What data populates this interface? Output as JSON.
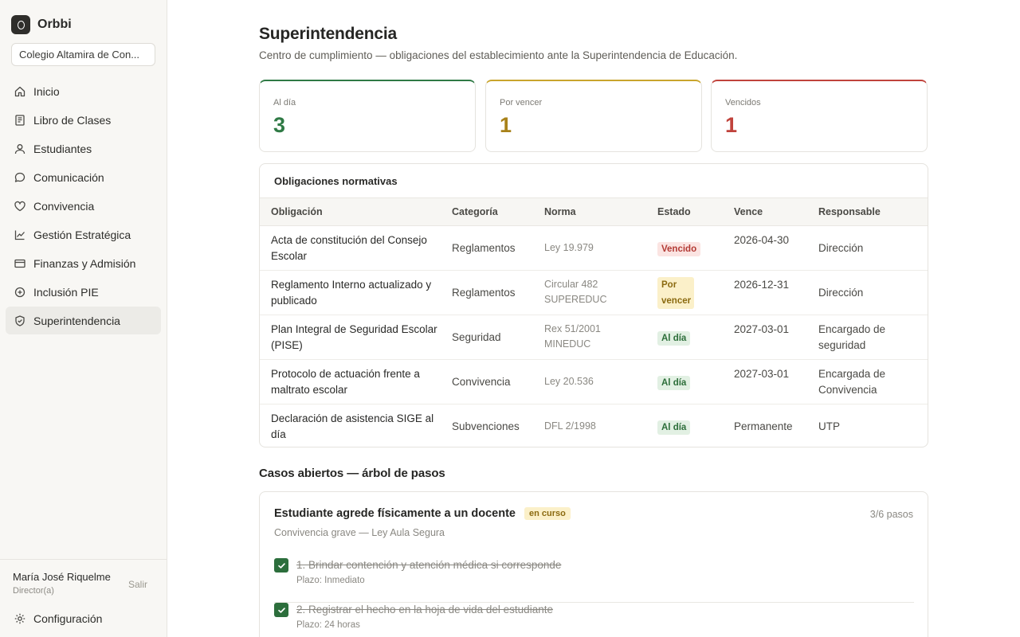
{
  "app": {
    "name": "Orbbi"
  },
  "sidebar": {
    "school": "Colegio Altamira de Con...",
    "items": [
      {
        "label": "Inicio",
        "icon": "home-icon"
      },
      {
        "label": "Libro de Clases",
        "icon": "book-icon"
      },
      {
        "label": "Estudiantes",
        "icon": "user-icon"
      },
      {
        "label": "Comunicación",
        "icon": "chat-icon"
      },
      {
        "label": "Convivencia",
        "icon": "heart-icon"
      },
      {
        "label": "Gestión Estratégica",
        "icon": "chart-icon"
      },
      {
        "label": "Finanzas y Admisión",
        "icon": "card-icon"
      },
      {
        "label": "Inclusión PIE",
        "icon": "plus-circle-icon"
      },
      {
        "label": "Superintendencia",
        "icon": "shield-icon",
        "active": true
      }
    ],
    "user": {
      "name": "María José Riquelme",
      "role": "Director(a)",
      "logout": "Salir"
    },
    "settings": "Configuración"
  },
  "page": {
    "title": "Superintendencia",
    "subtitle": "Centro de cumplimiento — obligaciones del establecimiento ante la Superintendencia de Educación."
  },
  "kpis": [
    {
      "label": "Al día",
      "value": "3",
      "color": "#2f7a45"
    },
    {
      "label": "Por vencer",
      "value": "1",
      "color": "#a8821a"
    },
    {
      "label": "Vencidos",
      "value": "1",
      "color": "#c0433c"
    }
  ],
  "obligations": {
    "title": "Obligaciones normativas",
    "headers": [
      "Obligación",
      "Categoría",
      "Norma",
      "Estado",
      "Vence",
      "Responsable"
    ],
    "rows": [
      {
        "obligacion": "Acta de constitución del Consejo Escolar",
        "categoria": "Reglamentos",
        "norma": "Ley 19.979",
        "estado": "Vencido",
        "estado_type": "overdue",
        "vence": "2026-04-30",
        "responsable": "Dirección"
      },
      {
        "obligacion": "Reglamento Interno actualizado y publicado",
        "categoria": "Reglamentos",
        "norma": "Circular 482 SUPEREDUC",
        "estado": "Por vencer",
        "estado_type": "warn",
        "vence": "2026-12-31",
        "responsable": "Dirección"
      },
      {
        "obligacion": "Plan Integral de Seguridad Escolar (PISE)",
        "categoria": "Seguridad",
        "norma": "Rex 51/2001 MINEDUC",
        "estado": "Al día",
        "estado_type": "ok",
        "vence": "2027-03-01",
        "responsable": "Encargado de seguridad"
      },
      {
        "obligacion": "Protocolo de actuación frente a maltrato escolar",
        "categoria": "Convivencia",
        "norma": "Ley 20.536",
        "estado": "Al día",
        "estado_type": "ok",
        "vence": "2027-03-01",
        "responsable": "Encargada de Convivencia"
      },
      {
        "obligacion": "Declaración de asistencia SIGE al día",
        "categoria": "Subvenciones",
        "norma": "DFL 2/1998",
        "estado": "Al día",
        "estado_type": "ok",
        "vence": "Permanente",
        "responsable": "UTP"
      }
    ]
  },
  "cases": {
    "title": "Casos abiertos — árbol de pasos",
    "items": [
      {
        "title": "Estudiante agrede físicamente a un docente",
        "status": "en curso",
        "progress": "3/6 pasos",
        "subtitle": "Convivencia grave — Ley Aula Segura",
        "steps": [
          {
            "text": "1. Brindar contención y atención médica si corresponde",
            "deadline": "Plazo: Inmediato",
            "done": true
          },
          {
            "text": "2. Registrar el hecho en la hoja de vida del estudiante",
            "deadline": "Plazo: 24 horas",
            "done": true
          }
        ]
      }
    ]
  }
}
